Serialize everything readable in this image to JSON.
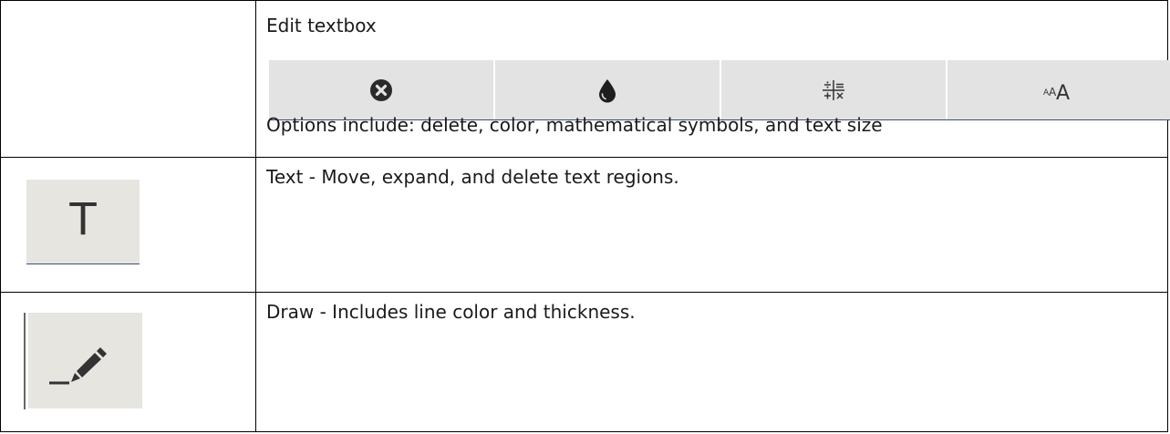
{
  "rows": [
    {
      "title": "Edit textbox",
      "toolbar": [
        {
          "icon": "delete-circle-x-icon"
        },
        {
          "icon": "color-drop-icon"
        },
        {
          "icon": "math-symbols-icon"
        },
        {
          "icon": "text-size-icon",
          "glyph": "AAA"
        }
      ],
      "options": "Options include: delete, color, mathematical symbols, and text size"
    },
    {
      "icon": "text-tool-icon",
      "icon_glyph": "T",
      "description": "Text - Move, expand, and delete text regions."
    },
    {
      "icon": "draw-pencil-icon",
      "description": "Draw -  Includes line color and thickness."
    }
  ],
  "colors": {
    "toolbar_bg": "#e3e3e3",
    "icon_box_bg": "#e6e5e0",
    "icon_fill": "#2a2a2a",
    "underline": "#3f4f6b"
  }
}
